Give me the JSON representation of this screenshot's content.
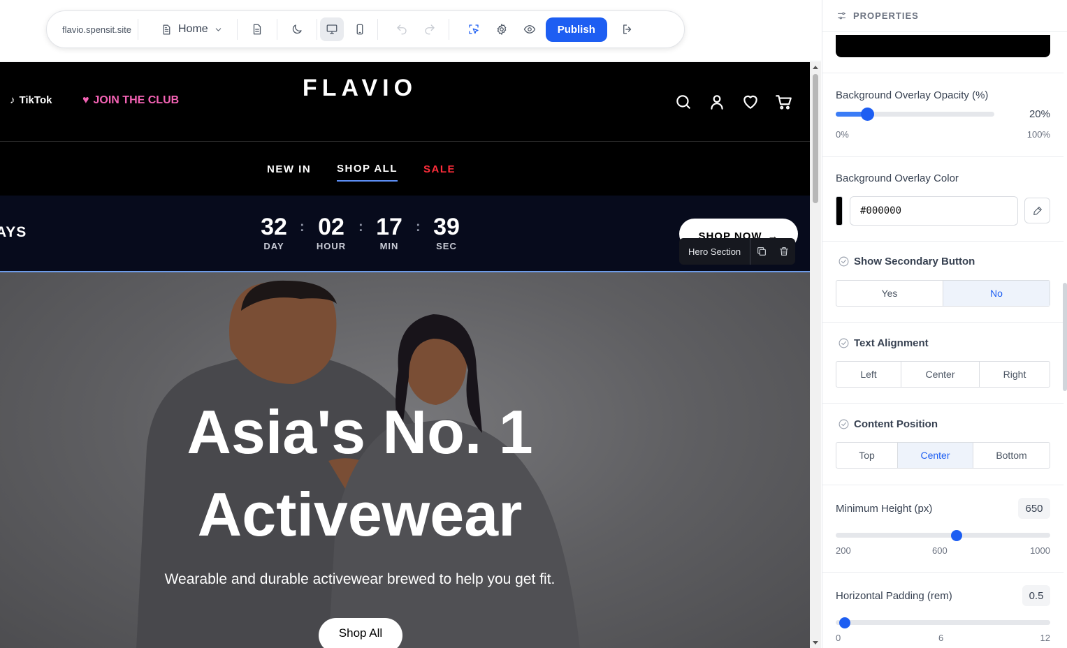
{
  "toolbar": {
    "site": "flavio.spensit.site",
    "page": "Home",
    "publish_label": "Publish"
  },
  "store": {
    "tiktok_label": "TikTok",
    "club_label": "JOIN THE CLUB",
    "brand": "FLAVIO",
    "nav": [
      {
        "label": "NEW IN"
      },
      {
        "label": "SHOP ALL"
      },
      {
        "label": "SALE"
      }
    ],
    "countdown": {
      "days_label_partial": "AYS",
      "units": [
        {
          "value": "32",
          "label": "DAY"
        },
        {
          "value": "02",
          "label": "HOUR"
        },
        {
          "value": "17",
          "label": "MIN"
        },
        {
          "value": "39",
          "label": "SEC"
        }
      ],
      "shop_now_label": "SHOP NOW"
    },
    "section_tag": "Hero Section",
    "hero": {
      "title_line1": "Asia's No. 1",
      "title_line2": "Activewear",
      "subtitle": "Wearable and durable activewear brewed to help you get fit.",
      "button_label": "Shop All"
    }
  },
  "panel": {
    "title": "PROPERTIES",
    "overlay_opacity": {
      "label": "Background Overlay Opacity (%)",
      "value": 20,
      "display": "20%",
      "min_label": "0%",
      "max_label": "100%"
    },
    "overlay_color": {
      "label": "Background Overlay Color",
      "value": "#000000"
    },
    "secondary_button": {
      "label": "Show Secondary Button",
      "options": [
        "Yes",
        "No"
      ],
      "selected": "No"
    },
    "text_alignment": {
      "label": "Text Alignment",
      "options": [
        "Left",
        "Center",
        "Right"
      ],
      "selected": null
    },
    "content_position": {
      "label": "Content Position",
      "options": [
        "Top",
        "Center",
        "Bottom"
      ],
      "selected": "Center"
    },
    "min_height": {
      "label": "Minimum Height (px)",
      "value": 650,
      "ticks": [
        "200",
        "600",
        "1000"
      ]
    },
    "h_padding": {
      "label": "Horizontal Padding (rem)",
      "value": 0.5,
      "ticks": [
        "0",
        "6",
        "12"
      ]
    }
  },
  "colors": {
    "accent": "#1d5ef2",
    "sale": "#ff2d3b",
    "club": "#f563b5",
    "countdown_bg": "#070b1c"
  }
}
